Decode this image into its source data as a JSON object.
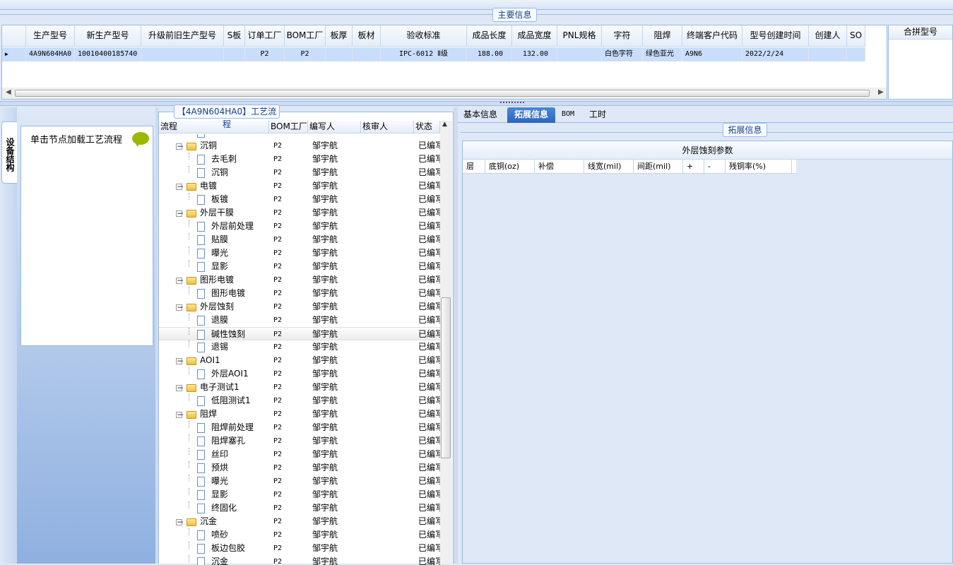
{
  "main_section": {
    "title": "主要信息"
  },
  "grid": {
    "columns": [
      "生产型号",
      "新生产型号",
      "升级前旧生产型号",
      "S板",
      "订单工厂",
      "BOM工厂",
      "板厚",
      "板材",
      "验收标准",
      "成品长度",
      "成品宽度",
      "PNL规格",
      "字符",
      "阻焊",
      "终端客户代码",
      "型号创建时间",
      "创建人",
      "SO"
    ],
    "row": [
      "4A9N604HA0",
      "10010400185740",
      "",
      "",
      "P2",
      "P2",
      "",
      "",
      "IPC-6012 Ⅱ级",
      "188.00",
      "132.00",
      "",
      "白色字符",
      "绿色亚光",
      "A9N6",
      "2022/2/24",
      "",
      ""
    ],
    "merge_header": "合拼型号"
  },
  "left": {
    "vertical_tab": "设备结构",
    "hint": "单击节点加载工艺流程"
  },
  "tree": {
    "title": "【4A9N604HA0】工艺流程",
    "columns": [
      "流程",
      "BOM工厂",
      "编写人",
      "核审人",
      "状态"
    ],
    "rows": [
      {
        "level": 1,
        "name": "沉铜",
        "bom": "P2",
        "writer": "邹宇航",
        "status": "已编写"
      },
      {
        "level": 2,
        "name": "去毛刺",
        "bom": "P2",
        "writer": "邹宇航",
        "status": "已编写"
      },
      {
        "level": 2,
        "name": "沉铜",
        "bom": "P2",
        "writer": "邹宇航",
        "status": "已编写"
      },
      {
        "level": 1,
        "name": "电镀",
        "bom": "P2",
        "writer": "邹宇航",
        "status": "已编写"
      },
      {
        "level": 2,
        "name": "板镀",
        "bom": "P2",
        "writer": "邹宇航",
        "status": "已编写"
      },
      {
        "level": 1,
        "name": "外层干膜",
        "bom": "P2",
        "writer": "邹宇航",
        "status": "已编写"
      },
      {
        "level": 2,
        "name": "外层前处理",
        "bom": "P2",
        "writer": "邹宇航",
        "status": "已编写"
      },
      {
        "level": 2,
        "name": "贴膜",
        "bom": "P2",
        "writer": "邹宇航",
        "status": "已编写"
      },
      {
        "level": 2,
        "name": "曝光",
        "bom": "P2",
        "writer": "邹宇航",
        "status": "已编写"
      },
      {
        "level": 2,
        "name": "显影",
        "bom": "P2",
        "writer": "邹宇航",
        "status": "已编写"
      },
      {
        "level": 1,
        "name": "图形电镀",
        "bom": "P2",
        "writer": "邹宇航",
        "status": "已编写"
      },
      {
        "level": 2,
        "name": "图形电镀",
        "bom": "P2",
        "writer": "邹宇航",
        "status": "已编写"
      },
      {
        "level": 1,
        "name": "外层蚀刻",
        "bom": "P2",
        "writer": "邹宇航",
        "status": "已编写"
      },
      {
        "level": 2,
        "name": "退膜",
        "bom": "P2",
        "writer": "邹宇航",
        "status": "已编写"
      },
      {
        "level": 2,
        "name": "碱性蚀刻",
        "bom": "P2",
        "writer": "邹宇航",
        "status": "已编写",
        "selected": true
      },
      {
        "level": 2,
        "name": "退锡",
        "bom": "P2",
        "writer": "邹宇航",
        "status": "已编写"
      },
      {
        "level": 1,
        "name": "AOI1",
        "bom": "P2",
        "writer": "邹宇航",
        "status": "已编写"
      },
      {
        "level": 2,
        "name": "外层AOI1",
        "bom": "P2",
        "writer": "邹宇航",
        "status": "已编写"
      },
      {
        "level": 1,
        "name": "电子测试1",
        "bom": "P2",
        "writer": "邹宇航",
        "status": "已编写"
      },
      {
        "level": 2,
        "name": "低阻测试1",
        "bom": "P2",
        "writer": "邹宇航",
        "status": "已编写"
      },
      {
        "level": 1,
        "name": "阻焊",
        "bom": "P2",
        "writer": "邹宇航",
        "status": "已编写"
      },
      {
        "level": 2,
        "name": "阻焊前处理",
        "bom": "P2",
        "writer": "邹宇航",
        "status": "已编写"
      },
      {
        "level": 2,
        "name": "阻焊塞孔",
        "bom": "P2",
        "writer": "邹宇航",
        "status": "已编写"
      },
      {
        "level": 2,
        "name": "丝印",
        "bom": "P2",
        "writer": "邹宇航",
        "status": "已编写"
      },
      {
        "level": 2,
        "name": "预烘",
        "bom": "P2",
        "writer": "邹宇航",
        "status": "已编写"
      },
      {
        "level": 2,
        "name": "曝光",
        "bom": "P2",
        "writer": "邹宇航",
        "status": "已编写"
      },
      {
        "level": 2,
        "name": "显影",
        "bom": "P2",
        "writer": "邹宇航",
        "status": "已编写"
      },
      {
        "level": 2,
        "name": "终固化",
        "bom": "P2",
        "writer": "邹宇航",
        "status": "已编写"
      },
      {
        "level": 1,
        "name": "沉金",
        "bom": "P2",
        "writer": "邹宇航",
        "status": "已编写"
      },
      {
        "level": 2,
        "name": "喷砂",
        "bom": "P2",
        "writer": "邹宇航",
        "status": "已编写"
      },
      {
        "level": 2,
        "name": "板边包胶",
        "bom": "P2",
        "writer": "邹宇航",
        "status": "已编写"
      },
      {
        "level": 2,
        "name": "沉金",
        "bom": "P2",
        "writer": "邹宇航",
        "status": "已编写"
      }
    ]
  },
  "right": {
    "tabs": [
      "基本信息",
      "拓展信息",
      "BOM",
      "工时"
    ],
    "active_tab": "拓展信息",
    "section_title": "拓展信息",
    "grid_title": "外层蚀刻参数",
    "columns": [
      "层",
      "底铜(oz)",
      "补偿",
      "线宽(mil)",
      "间距(mil)",
      "+",
      "-",
      "残铜率(%)"
    ]
  },
  "colors": {
    "accent": "#2c66be",
    "border": "#99bbe8",
    "selected_row": "#c9defa"
  }
}
